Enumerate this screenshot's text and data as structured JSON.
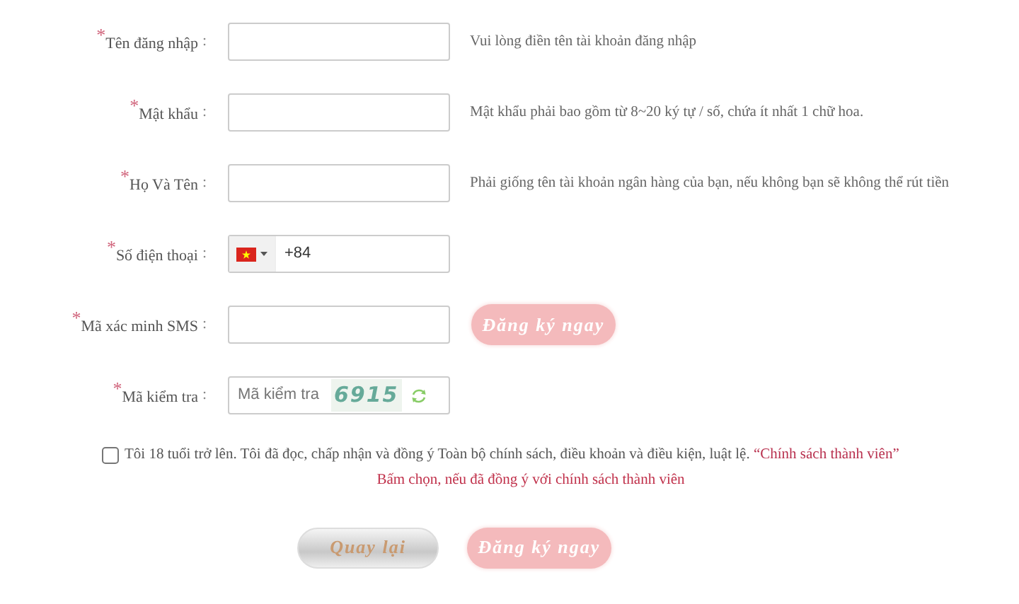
{
  "fields": [
    {
      "kind": "text",
      "label": "$^{*}$Tên đăng nhập",
      "colon": ":",
      "hint": "Vui lòng điền tên tài khoản đăng nhập"
    },
    {
      "kind": "text",
      "label": "$^{*}$Mật khẩu",
      "colon": ":",
      "hint": "Mật khẩu phải bao gồm từ 8~20 ký tự / số, chứa ít nhất 1 chữ hoa."
    },
    {
      "kind": "text",
      "label": "$^{*}$Họ Và Tên",
      "colon": ":",
      "hint": "Phải giống tên tài khoản ngân hàng của bạn, nếu không bạn sẽ không thể rút tiền"
    },
    {
      "kind": "phone",
      "label": "$^{*}$Số điện thoại",
      "colon": ":",
      "value": "+84"
    },
    {
      "kind": "sms",
      "label": "$^{*}$Mã xác minh SMS",
      "colon": ":",
      "button": "Đăng ký ngay"
    },
    {
      "kind": "captcha",
      "label": "$^{*}$Mã kiểm tra",
      "colon": ":",
      "placeholder": "Mã kiểm tra",
      "code": "6915"
    }
  ],
  "agreement": {
    "checked": false,
    "text": "Tôi 18 tuổi trở lên. Tôi đã đọc, chấp nhận và đồng ý Toàn bộ chính sách, điều khoản và điều kiện, luật lệ.",
    "link": "“Chính sách thành viên”",
    "error": "Bấm chọn, nếu đã đồng ý với chính sách thành viên"
  },
  "buttons": [
    {
      "kind": "back",
      "label": "Quay lại"
    },
    {
      "kind": "submit",
      "label": "Đăng ký ngay"
    }
  ]
}
